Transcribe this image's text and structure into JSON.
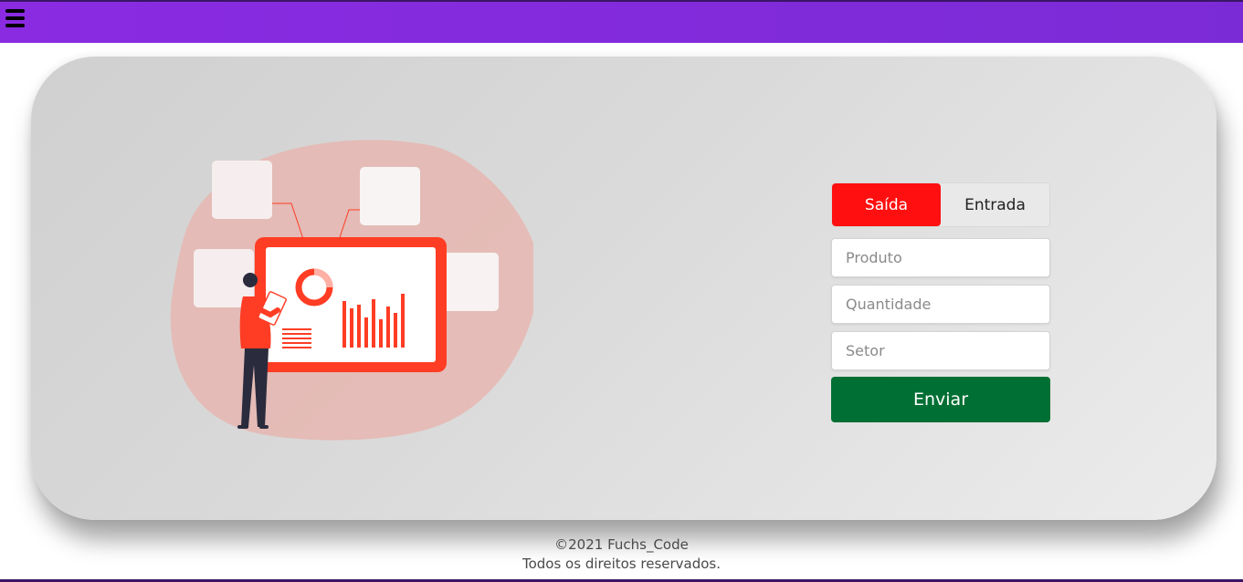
{
  "header": {
    "menu_icon": "hamburger-menu-icon"
  },
  "illustration": {
    "subject": "analyst-presenting-chart",
    "accent": "#ff3d24"
  },
  "form": {
    "tabs": [
      {
        "label": "Saída",
        "active": true
      },
      {
        "label": "Entrada",
        "active": false
      }
    ],
    "fields": {
      "produto": {
        "placeholder": "Produto",
        "value": ""
      },
      "quantidade": {
        "placeholder": "Quantidade",
        "value": ""
      },
      "setor": {
        "placeholder": "Setor",
        "value": ""
      }
    },
    "submit_label": "Enviar"
  },
  "colors": {
    "topbar": "#8a2be2",
    "active_tab": "#ff0f0f",
    "submit": "#006f33"
  },
  "footer": {
    "copyright": "©2021 Fuchs_Code",
    "rights": "Todos os direitos reservados."
  }
}
